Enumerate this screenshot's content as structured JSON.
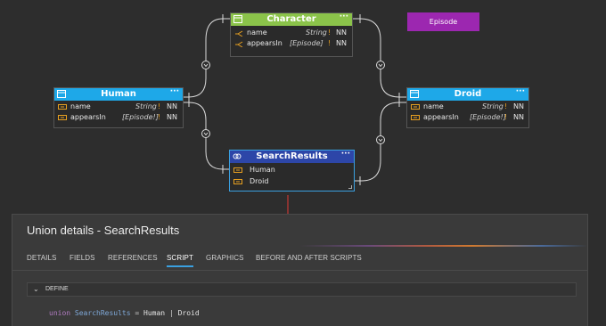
{
  "colors": {
    "canvas_bg": "#2d2d2d",
    "character_header": "#8bc34a",
    "human_header": "#1ea8e8",
    "droid_header": "#1ea8e8",
    "searchresults_header": "#2d46a8",
    "episode_fill": "#9c27b0",
    "required_mark": "#e8a020",
    "active_tab_underline": "#3aa0e0",
    "arrow": "#e53935"
  },
  "diagram": {
    "character": {
      "title": "Character",
      "icon": "interface-icon",
      "menu": "···",
      "fields": [
        {
          "name": "name",
          "type": "String",
          "req": "!",
          "nn": "NN",
          "icon": "implements-icon"
        },
        {
          "name": "appearsIn",
          "type": "[Episode]",
          "req": "!",
          "nn": "NN",
          "icon": "implements-icon"
        }
      ]
    },
    "episode": {
      "title": "Episode"
    },
    "human": {
      "title": "Human",
      "icon": "object-type-icon",
      "menu": "···",
      "fields": [
        {
          "name": "name",
          "type": "String",
          "req": "!",
          "nn": "NN",
          "icon": "field-icon"
        },
        {
          "name": "appearsIn",
          "type": "[Episode!]",
          "req": "!",
          "nn": "NN",
          "icon": "field-icon"
        }
      ]
    },
    "droid": {
      "title": "Droid",
      "icon": "object-type-icon",
      "menu": "···",
      "fields": [
        {
          "name": "name",
          "type": "String",
          "req": "!",
          "nn": "NN",
          "icon": "field-icon"
        },
        {
          "name": "appearsIn",
          "type": "[Episode!]",
          "req": "!",
          "nn": "NN",
          "icon": "field-icon"
        }
      ]
    },
    "searchresults": {
      "title": "SearchResults",
      "icon": "union-icon",
      "menu": "···",
      "members": [
        {
          "name": "Human",
          "icon": "field-icon"
        },
        {
          "name": "Droid",
          "icon": "field-icon"
        }
      ]
    }
  },
  "panel": {
    "title": "Union details - SearchResults",
    "tabs": [
      "DETAILS",
      "FIELDS",
      "REFERENCES",
      "SCRIPT",
      "GRAPHICS",
      "BEFORE AND AFTER SCRIPTS"
    ],
    "active_tab": "SCRIPT",
    "define_label": "DEFINE",
    "code": {
      "keyword": "union",
      "name": "SearchResults",
      "eq": "=",
      "member1": "Human",
      "sep": "|",
      "member2": "Droid"
    }
  }
}
